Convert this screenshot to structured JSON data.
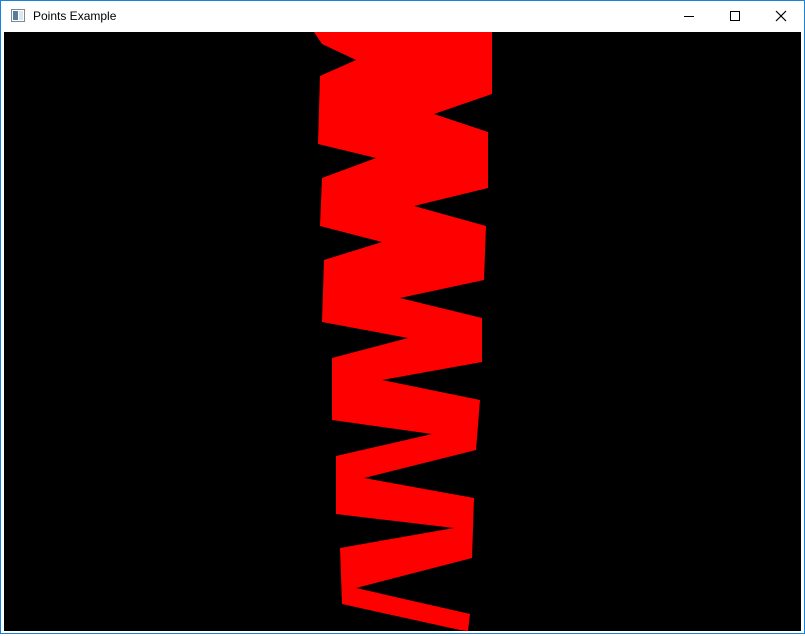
{
  "window": {
    "title": "Points Example",
    "icon": "app-window-icon",
    "border_color": "#1883d7"
  },
  "controls": {
    "minimize_icon": "minimize-icon",
    "maximize_icon": "maximize-icon",
    "close_icon": "close-icon"
  },
  "canvas": {
    "background_color": "#000000",
    "shape": "red zigzag band",
    "shape_color": "#ff0000"
  }
}
